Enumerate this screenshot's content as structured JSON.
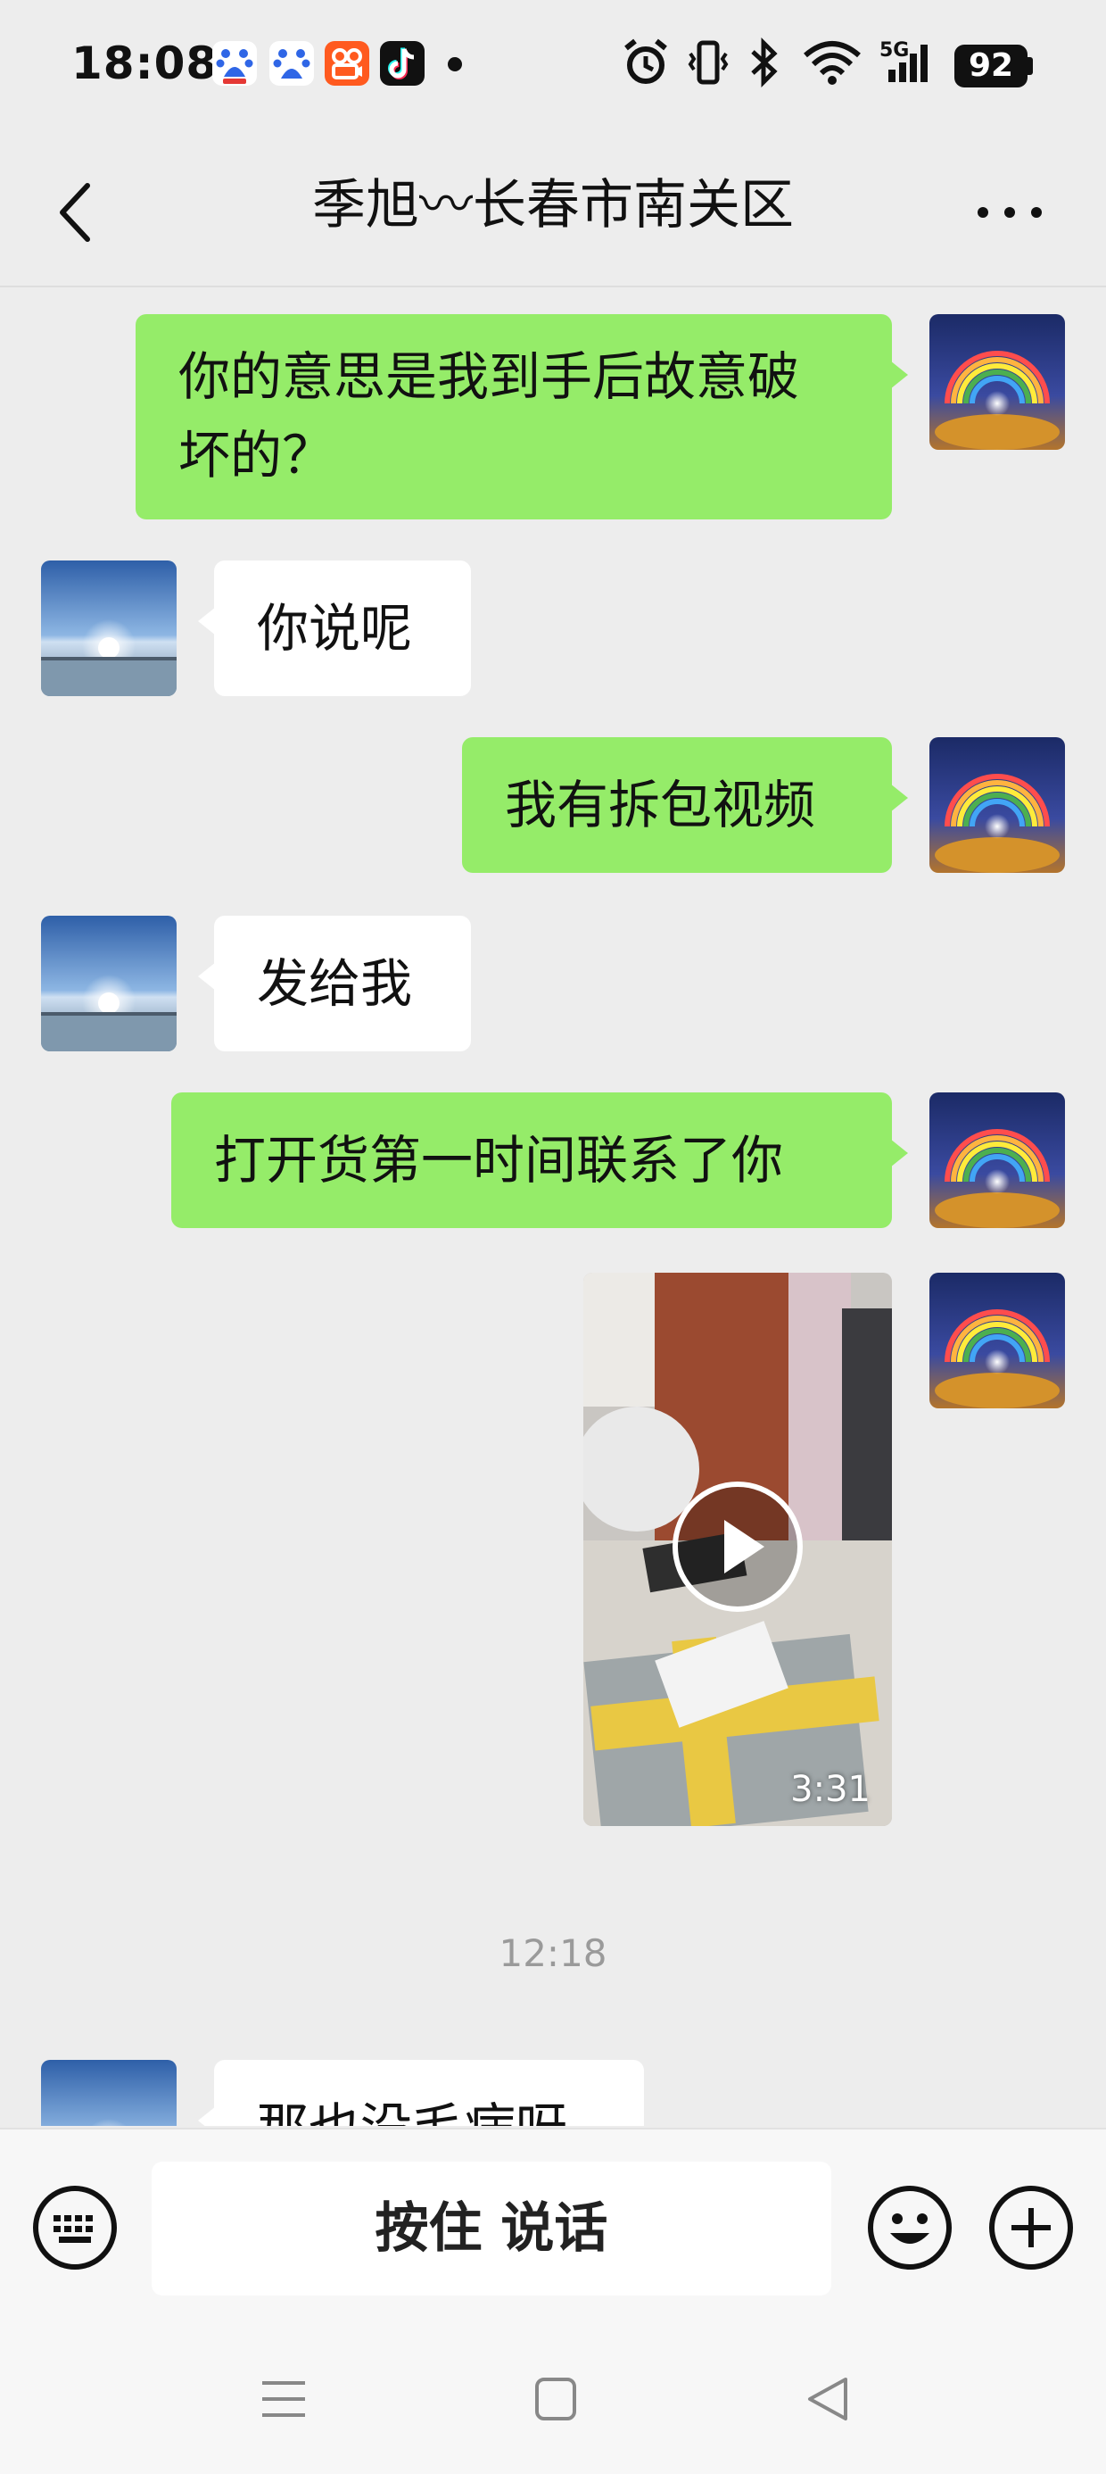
{
  "status_bar": {
    "time": "18:08",
    "battery": "92",
    "network": "5G",
    "apps": [
      "baidu-icon",
      "baidu-input-icon",
      "kuaishou-icon",
      "tiktok-icon"
    ]
  },
  "header": {
    "title": "季旭〰长春市南关区",
    "back_icon": "chevron-left-icon",
    "more_icon": "more-dots-icon"
  },
  "messages": [
    {
      "side": "me",
      "type": "text",
      "text": "你的意思是我到手后故意破坏的？"
    },
    {
      "side": "other",
      "type": "text",
      "text": "你说呢"
    },
    {
      "side": "me",
      "type": "text",
      "text": "我有拆包视频"
    },
    {
      "side": "other",
      "type": "text",
      "text": "发给我"
    },
    {
      "side": "me",
      "type": "text",
      "text": "打开货第一时间联系了你"
    },
    {
      "side": "me",
      "type": "video",
      "duration": "3:31"
    },
    {
      "side": "other",
      "type": "text",
      "text": "那也没毛病呀"
    }
  ],
  "timestamp": "12:18",
  "input_bar": {
    "voice_label": "按住 说话",
    "keyboard_icon": "keyboard-icon",
    "emoji_icon": "emoji-icon",
    "plus_icon": "plus-icon"
  },
  "colors": {
    "me_bubble": "#95ec69",
    "other_bubble": "#ffffff",
    "background": "#ededed"
  }
}
